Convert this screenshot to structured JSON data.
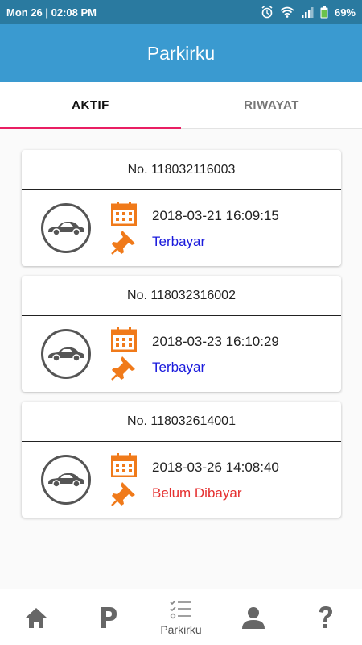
{
  "status_bar": {
    "time": "Mon 26 | 02:08 PM",
    "battery": "69%"
  },
  "app_bar": {
    "title": "Parkirku"
  },
  "tabs": [
    {
      "label": "AKTIF",
      "active": true
    },
    {
      "label": "RIWAYAT",
      "active": false
    }
  ],
  "tickets": [
    {
      "number": "No. 118032116003",
      "date": "2018-03-21 16:09:15",
      "status": "Terbayar",
      "status_color": "#1a1adc"
    },
    {
      "number": "No. 118032316002",
      "date": "2018-03-23 16:10:29",
      "status": "Terbayar",
      "status_color": "#1a1adc"
    },
    {
      "number": "No. 118032614001",
      "date": "2018-03-26 14:08:40",
      "status": "Belum Dibayar",
      "status_color": "#e53030"
    }
  ],
  "bottom_nav": {
    "items": [
      {
        "icon": "home-icon",
        "label": ""
      },
      {
        "icon": "parking-icon",
        "label": ""
      },
      {
        "icon": "checklist-icon",
        "label": "Parkirku"
      },
      {
        "icon": "person-icon",
        "label": ""
      },
      {
        "icon": "help-icon",
        "label": ""
      }
    ]
  },
  "colors": {
    "status_bar": "#2a7aa0",
    "app_bar": "#3a9ad0",
    "tab_indicator": "#e91e63",
    "accent_orange": "#f07a1a"
  }
}
